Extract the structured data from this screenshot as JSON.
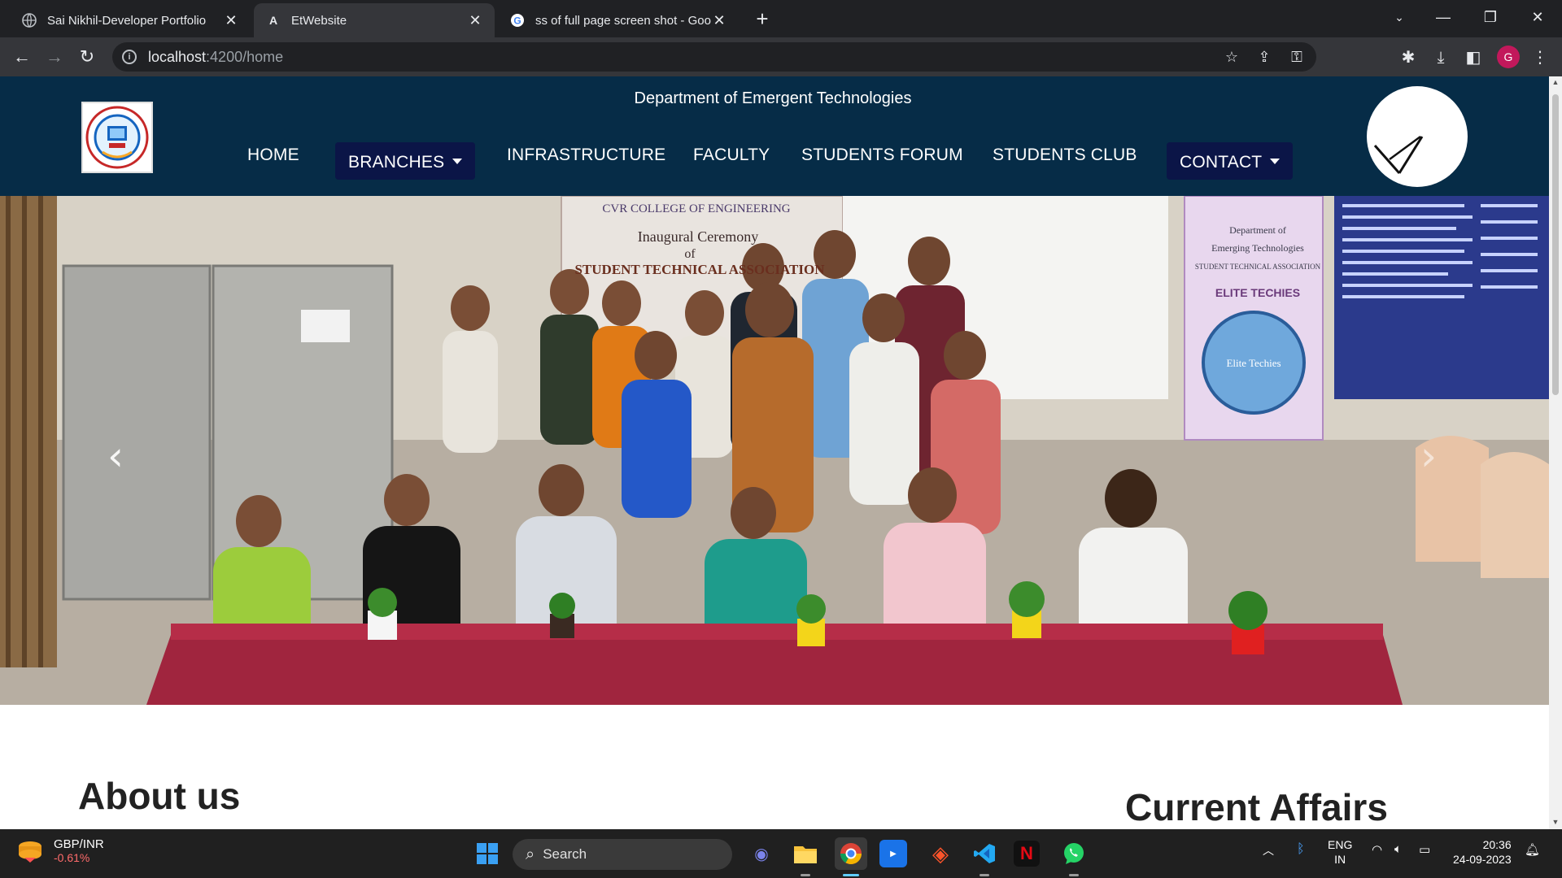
{
  "browser": {
    "tabs": [
      {
        "title": "Sai Nikhil-Developer Portfolio",
        "active": false
      },
      {
        "title": "EtWebsite",
        "active": true
      },
      {
        "title": "ss of full page screen shot - Goo",
        "active": false
      }
    ],
    "url_host": "localhost",
    "url_path": ":4200/home"
  },
  "site": {
    "department": "Department of Emergent Technologies",
    "nav": {
      "home": "HOME",
      "branches": "BRANCHES",
      "infrastructure": "INFRASTRUCTURE",
      "faculty": "FACULTY",
      "students_forum": "STUDENTS FORUM",
      "students_club": "STUDENTS CLUB",
      "contact": "CONTACT"
    },
    "banner": {
      "college": "CVR COLLEGE OF ENGINEERING",
      "ceremony_line1": "Inaugural Ceremony",
      "ceremony_line2": "of",
      "ceremony_line3": "STUDENT TECHNICAL ASSOCIATION",
      "poster_dept1": "Department of",
      "poster_dept2": "Emerging Technologies",
      "poster_assoc": "STUDENT TECHNICAL ASSOCIATION",
      "poster_club": "ELITE TECHIES",
      "poster_seal": "Elite Techies"
    },
    "about_heading": "About us",
    "affairs_heading": "Current Affairs",
    "colors": {
      "header": "#062c47",
      "dropdown": "#0b1547",
      "tablecloth": "#a0253e"
    }
  },
  "taskbar": {
    "ticker_pair": "GBP/INR",
    "ticker_change": "-0.61%",
    "search_label": "Search",
    "lang_top": "ENG",
    "lang_bottom": "IN",
    "time": "20:36",
    "date": "24-09-2023"
  }
}
